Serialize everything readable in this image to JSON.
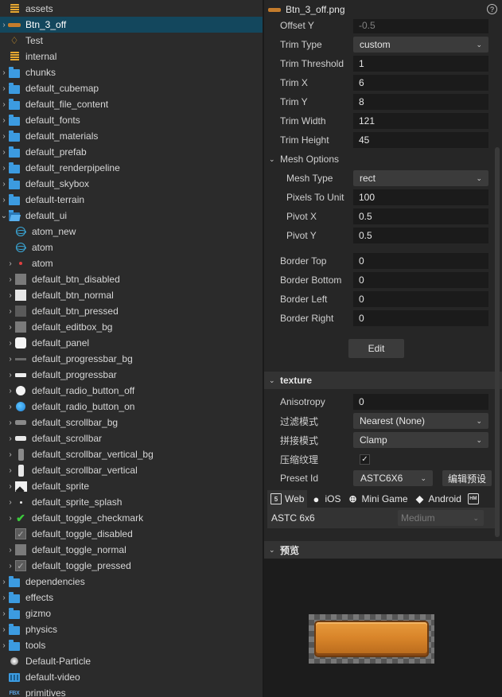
{
  "tree": {
    "items": [
      {
        "label": "assets",
        "icon": "database-icon",
        "arrow": "",
        "indent": 0
      },
      {
        "label": "Btn_3_off",
        "icon": "button-sprite-icon",
        "arrow": "›",
        "indent": 0,
        "selected": true
      },
      {
        "label": "Test",
        "icon": "drop-icon",
        "arrow": "",
        "indent": 0
      },
      {
        "label": "internal",
        "icon": "database-icon",
        "arrow": "",
        "indent": 0
      },
      {
        "label": "chunks",
        "icon": "folder-icon",
        "arrow": "›",
        "indent": 0
      },
      {
        "label": "default_cubemap",
        "icon": "folder-icon",
        "arrow": "›",
        "indent": 0
      },
      {
        "label": "default_file_content",
        "icon": "folder-icon",
        "arrow": "›",
        "indent": 0
      },
      {
        "label": "default_fonts",
        "icon": "folder-icon",
        "arrow": "›",
        "indent": 0
      },
      {
        "label": "default_materials",
        "icon": "folder-icon",
        "arrow": "›",
        "indent": 0
      },
      {
        "label": "default_prefab",
        "icon": "folder-icon",
        "arrow": "›",
        "indent": 0
      },
      {
        "label": "default_renderpipeline",
        "icon": "folder-icon",
        "arrow": "›",
        "indent": 0
      },
      {
        "label": "default_skybox",
        "icon": "folder-icon",
        "arrow": "›",
        "indent": 0
      },
      {
        "label": "default-terrain",
        "icon": "folder-icon",
        "arrow": "›",
        "indent": 0
      },
      {
        "label": "default_ui",
        "icon": "folder-open-icon",
        "arrow": "⌄",
        "indent": 0
      },
      {
        "label": "atom_new",
        "icon": "atom-icon",
        "arrow": "",
        "indent": 1
      },
      {
        "label": "atom",
        "icon": "atom-icon",
        "arrow": "",
        "indent": 1
      },
      {
        "label": "atom",
        "icon": "red-dot-icon",
        "arrow": "›",
        "indent": 1
      },
      {
        "label": "default_btn_disabled",
        "icon": "dark-square-icon",
        "arrow": "›",
        "indent": 1
      },
      {
        "label": "default_btn_normal",
        "icon": "light-square-icon",
        "arrow": "›",
        "indent": 1
      },
      {
        "label": "default_btn_pressed",
        "icon": "mid-square-icon",
        "arrow": "›",
        "indent": 1
      },
      {
        "label": "default_editbox_bg",
        "icon": "dark-square-icon",
        "arrow": "›",
        "indent": 1
      },
      {
        "label": "default_panel",
        "icon": "rounded-square-icon",
        "arrow": "›",
        "indent": 1
      },
      {
        "label": "default_progressbar_bg",
        "icon": "gray-bar-icon",
        "arrow": "›",
        "indent": 1
      },
      {
        "label": "default_progressbar",
        "icon": "white-bar-icon",
        "arrow": "›",
        "indent": 1
      },
      {
        "label": "default_radio_button_off",
        "icon": "white-circle-icon",
        "arrow": "›",
        "indent": 1
      },
      {
        "label": "default_radio_button_on",
        "icon": "blue-circle-icon",
        "arrow": "›",
        "indent": 1
      },
      {
        "label": "default_scrollbar_bg",
        "icon": "scrollbar-bg-icon",
        "arrow": "›",
        "indent": 1
      },
      {
        "label": "default_scrollbar",
        "icon": "scrollbar-icon",
        "arrow": "›",
        "indent": 1
      },
      {
        "label": "default_scrollbar_vertical_bg",
        "icon": "vertical-scrollbar-bg-icon",
        "arrow": "›",
        "indent": 1
      },
      {
        "label": "default_scrollbar_vertical",
        "icon": "vertical-scrollbar-icon",
        "arrow": "›",
        "indent": 1
      },
      {
        "label": "default_sprite",
        "icon": "sprite-image-icon",
        "arrow": "›",
        "indent": 1
      },
      {
        "label": "default_sprite_splash",
        "icon": "white-dot-icon",
        "arrow": "›",
        "indent": 1
      },
      {
        "label": "default_toggle_checkmark",
        "icon": "checkmark-icon",
        "arrow": "›",
        "indent": 1
      },
      {
        "label": "default_toggle_disabled",
        "icon": "checkbox-icon",
        "arrow": "",
        "indent": 1
      },
      {
        "label": "default_toggle_normal",
        "icon": "gray-square-icon",
        "arrow": "›",
        "indent": 1
      },
      {
        "label": "default_toggle_pressed",
        "icon": "checkbox-icon",
        "arrow": "›",
        "indent": 1
      },
      {
        "label": "dependencies",
        "icon": "folder-icon",
        "arrow": "›",
        "indent": 0
      },
      {
        "label": "effects",
        "icon": "folder-icon",
        "arrow": "›",
        "indent": 0
      },
      {
        "label": "gizmo",
        "icon": "folder-icon",
        "arrow": "›",
        "indent": 0
      },
      {
        "label": "physics",
        "icon": "folder-icon",
        "arrow": "›",
        "indent": 0
      },
      {
        "label": "tools",
        "icon": "folder-icon",
        "arrow": "›",
        "indent": 0
      },
      {
        "label": "Default-Particle",
        "icon": "particle-icon",
        "arrow": "",
        "indent": 0
      },
      {
        "label": "default-video",
        "icon": "video-icon",
        "arrow": "",
        "indent": 0
      },
      {
        "label": "primitives",
        "icon": "fbx-icon",
        "arrow": "",
        "indent": 0
      }
    ]
  },
  "inspector": {
    "title": "Btn_3_off.png",
    "help_glyph": "?",
    "props": {
      "offset_y": {
        "label": "Offset Y",
        "value": "-0.5"
      },
      "trim_type": {
        "label": "Trim Type",
        "value": "custom"
      },
      "trim_threshold": {
        "label": "Trim Threshold",
        "value": "1"
      },
      "trim_x": {
        "label": "Trim X",
        "value": "6"
      },
      "trim_y": {
        "label": "Trim Y",
        "value": "8"
      },
      "trim_width": {
        "label": "Trim Width",
        "value": "121"
      },
      "trim_height": {
        "label": "Trim Height",
        "value": "45"
      },
      "mesh_options": {
        "label": "Mesh Options"
      },
      "mesh_type": {
        "label": "Mesh Type",
        "value": "rect"
      },
      "pixels_to_unit": {
        "label": "Pixels To Unit",
        "value": "100"
      },
      "pivot_x": {
        "label": "Pivot X",
        "value": "0.5"
      },
      "pivot_y": {
        "label": "Pivot Y",
        "value": "0.5"
      },
      "border_top": {
        "label": "Border Top",
        "value": "0"
      },
      "border_bottom": {
        "label": "Border Bottom",
        "value": "0"
      },
      "border_left": {
        "label": "Border Left",
        "value": "0"
      },
      "border_right": {
        "label": "Border Right",
        "value": "0"
      }
    },
    "edit_button": "Edit",
    "texture": {
      "section_label": "texture",
      "anisotropy": {
        "label": "Anisotropy",
        "value": "0"
      },
      "filter": {
        "label": "过滤模式",
        "value": "Nearest (None)"
      },
      "wrap": {
        "label": "拼接模式",
        "value": "Clamp"
      },
      "compress": {
        "label": "压缩纹理",
        "checked": true
      },
      "preset": {
        "label": "Preset Id",
        "value": "ASTC6X6",
        "edit_button": "编辑预设"
      }
    },
    "platform_tabs": [
      {
        "label": "Web",
        "icon": "html5-icon"
      },
      {
        "label": "iOS",
        "icon": "apple-icon"
      },
      {
        "label": "Mini Game",
        "icon": "gamepad-icon"
      },
      {
        "label": "Android",
        "icon": "android-icon"
      },
      {
        "label": "",
        "icon": "harmonyos-icon"
      }
    ],
    "platform_format": {
      "name": "ASTC 6x6",
      "quality": "Medium"
    },
    "preview": {
      "section_label": "预览"
    }
  },
  "colors": {
    "selection": "#13475d",
    "folder": "#3c9be0",
    "accent_orange": "#d9852a",
    "checkmark_green": "#3ccb3c"
  }
}
